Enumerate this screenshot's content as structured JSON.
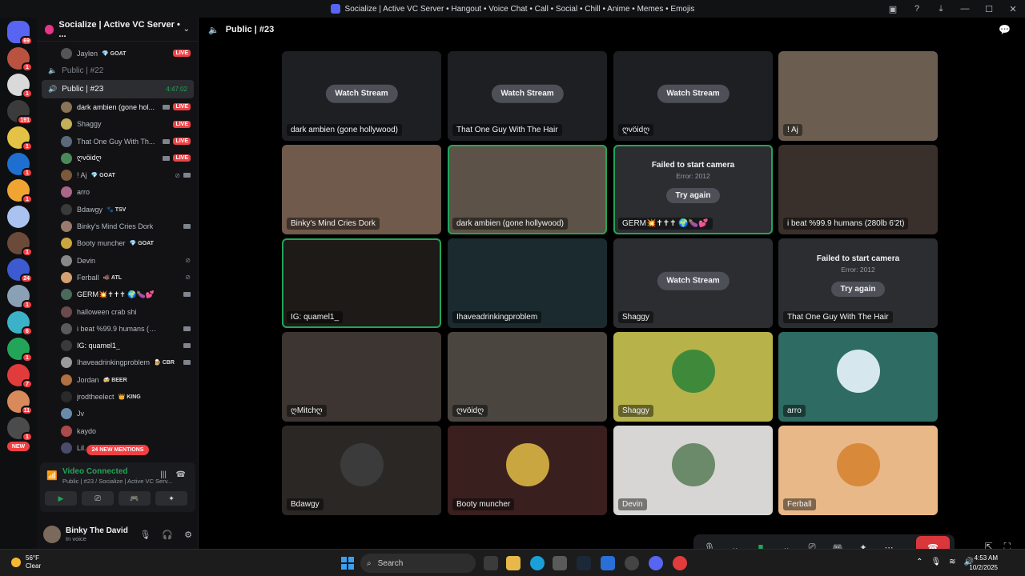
{
  "window": {
    "title": "Socialize | Active VC Server • Hangout • Voice Chat • Call • Social • Chill • Anime • Memes • Emojis"
  },
  "rail": {
    "servers": [
      {
        "color": "#5865f2",
        "badge": "69"
      },
      {
        "color": "#b9523f",
        "badge": "1"
      },
      {
        "color": "#d9d9d9",
        "badge": "1"
      },
      {
        "color": "#3b3b3b",
        "badge": "191"
      },
      {
        "color": "#e3c245",
        "badge": "1"
      },
      {
        "color": "#1f6fd1",
        "badge": "1"
      },
      {
        "color": "#f0a431",
        "badge": "1"
      },
      {
        "color": "#a9c2f0",
        "badge": ""
      },
      {
        "color": "#6b4a3a",
        "badge": "1"
      },
      {
        "color": "#3d5ad1",
        "badge": "24"
      },
      {
        "color": "#8aa1b5",
        "badge": "1"
      },
      {
        "color": "#3bb2c8",
        "badge": "6"
      },
      {
        "color": "#23a559",
        "badge": "1"
      },
      {
        "color": "#e23b3b",
        "badge": "7"
      },
      {
        "color": "#d88a5a",
        "badge": "11"
      },
      {
        "color": "#4b4b4b",
        "badge": "1"
      }
    ],
    "new_label": "NEW"
  },
  "sidebar": {
    "guild_name": "Socialize | Active VC Server • ...",
    "top_user": {
      "name": "Jaylen",
      "tag": "💎 GOAT",
      "live": "LIVE"
    },
    "channel_22": "Public | #22",
    "channel_23": "Public | #23",
    "channel_23_timer": "4:47:02",
    "users": [
      {
        "name": "dark ambien (gone hol...",
        "tag": "",
        "live": "LIVE",
        "cam": true,
        "muted": false,
        "bright": true,
        "color": "#8b7355"
      },
      {
        "name": "Shaggy",
        "tag": "",
        "live": "LIVE",
        "cam": false,
        "muted": false,
        "bright": false,
        "color": "#c2b15a"
      },
      {
        "name": "That One Guy With Th...",
        "tag": "",
        "live": "LIVE",
        "cam": true,
        "muted": false,
        "bright": false,
        "color": "#5a6a7a"
      },
      {
        "name": "ღvöidღ",
        "tag": "",
        "live": "LIVE",
        "cam": true,
        "muted": false,
        "bright": true,
        "color": "#4a8a5a"
      },
      {
        "name": "! Aj",
        "tag": "💎 GOAT",
        "live": "",
        "cam": true,
        "muted": true,
        "bright": false,
        "color": "#7a5a3a"
      },
      {
        "name": "arro",
        "tag": "",
        "live": "",
        "cam": false,
        "muted": false,
        "bright": false,
        "color": "#aa6688"
      },
      {
        "name": "Bdawgy",
        "tag": "🐾 TSV",
        "live": "",
        "cam": false,
        "muted": false,
        "bright": false,
        "color": "#3a3a3a"
      },
      {
        "name": "Binky's Mind Cries Dork",
        "tag": "",
        "live": "",
        "cam": true,
        "muted": false,
        "bright": false,
        "color": "#9a7a6a"
      },
      {
        "name": "Booty muncher",
        "tag": "💎 GOAT",
        "live": "",
        "cam": false,
        "muted": false,
        "bright": false,
        "color": "#c9a640"
      },
      {
        "name": "Devin",
        "tag": "",
        "live": "",
        "cam": false,
        "muted": true,
        "bright": false,
        "color": "#888888"
      },
      {
        "name": "Ferball",
        "tag": "🐗 ATL",
        "live": "",
        "cam": false,
        "muted": true,
        "bright": false,
        "color": "#d4a070"
      },
      {
        "name": "GERM💥✝✝✝ 🌍🍆💕",
        "tag": "",
        "live": "",
        "cam": true,
        "muted": false,
        "bright": true,
        "color": "#4a6a5a"
      },
      {
        "name": "halloween crab shi",
        "tag": "",
        "live": "",
        "cam": false,
        "muted": false,
        "bright": false,
        "color": "#6a4a4a"
      },
      {
        "name": "i beat %99.9 humans (280lb 6...",
        "tag": "",
        "live": "",
        "cam": true,
        "muted": false,
        "bright": false,
        "color": "#5a5a5a"
      },
      {
        "name": "IG: quamel1_",
        "tag": "",
        "live": "",
        "cam": true,
        "muted": false,
        "bright": true,
        "color": "#3a3a3a"
      },
      {
        "name": "Ihaveadrinkingproblem",
        "tag": "🍺 CBR",
        "live": "",
        "cam": true,
        "muted": false,
        "bright": false,
        "color": "#9a9a9a"
      },
      {
        "name": "Jordan",
        "tag": "🍻 BEER",
        "live": "",
        "cam": false,
        "muted": false,
        "bright": false,
        "color": "#b07040"
      },
      {
        "name": "jrodtheelect",
        "tag": "👑 KING",
        "live": "",
        "cam": false,
        "muted": false,
        "bright": false,
        "color": "#2a2a2a"
      },
      {
        "name": "Jv",
        "tag": "",
        "live": "",
        "cam": false,
        "muted": false,
        "bright": false,
        "color": "#6a8aaa"
      },
      {
        "name": "kaydo",
        "tag": "",
        "live": "",
        "cam": false,
        "muted": false,
        "bright": false,
        "color": "#aa4a4a"
      },
      {
        "name": "Lil...",
        "tag": "",
        "live": "",
        "cam": false,
        "muted": false,
        "bright": false,
        "color": "#4a4a6a"
      }
    ],
    "mentions_label": "24 NEW MENTIONS",
    "voice_panel": {
      "status": "Video Connected",
      "subtitle": "Public | #23 / Socialize | Active VC Serv..."
    },
    "user_panel": {
      "name": "Binky The David",
      "status": "In voice"
    }
  },
  "main": {
    "channel_title": "Public | #23",
    "watch_label": "Watch Stream",
    "fail_title": "Failed to start camera",
    "fail_error": "Error: 2012",
    "try_again": "Try again",
    "tiles": [
      {
        "type": "stream",
        "label": "dark ambien (gone hollywood)",
        "bg": "#1e1f22"
      },
      {
        "type": "stream",
        "label": "That One Guy With The Hair",
        "bg": "#1e1f22"
      },
      {
        "type": "stream",
        "label": "ღvöidღ",
        "bg": "#1e1f22"
      },
      {
        "type": "video",
        "label": "! Aj",
        "bg": "#6b5d50"
      },
      {
        "type": "video",
        "label": "Binky's Mind Cries Dork",
        "bg": "#6f5a4c"
      },
      {
        "type": "video",
        "label": "dark ambien (gone hollywood)",
        "bg": "#5d5247",
        "speaking": true
      },
      {
        "type": "fail",
        "label": "GERM💥✝✝✝ 🌍🍆💕",
        "bg": "#2b2d31",
        "speaking": true
      },
      {
        "type": "video",
        "label": "i beat %99.9 humans (280lb 6'2t)",
        "bg": "#3a302b"
      },
      {
        "type": "video",
        "label": "IG: quamel1_",
        "bg": "#1e1a18",
        "speaking": true
      },
      {
        "type": "video",
        "label": "Ihaveadrinkingproblem",
        "bg": "#1b2a2e"
      },
      {
        "type": "stream",
        "label": "Shaggy",
        "bg": "#2b2d31"
      },
      {
        "type": "fail",
        "label": "That One Guy With The Hair",
        "bg": "#2b2d31"
      },
      {
        "type": "video",
        "label": "ღMitchღ",
        "bg": "#3d3531"
      },
      {
        "type": "video",
        "label": "ღvöidღ",
        "bg": "#4a463f"
      },
      {
        "type": "avatar",
        "label": "Shaggy",
        "bg": "#b7b24a",
        "avatar": "#3f8a3a"
      },
      {
        "type": "avatar",
        "label": "arro",
        "bg": "#2e6b62",
        "avatar": "#d6e8ee"
      },
      {
        "type": "avatar",
        "label": "Bdawgy",
        "bg": "#2a2725",
        "avatar": "#3b3b3b"
      },
      {
        "type": "avatar",
        "label": "Booty muncher",
        "bg": "#3a1f1f",
        "avatar": "#c9a640"
      },
      {
        "type": "avatar",
        "label": "Devin",
        "bg": "#d8d6d4",
        "avatar": "#6a8a6a"
      },
      {
        "type": "avatar",
        "label": "Ferball",
        "bg": "#e8b889",
        "avatar": "#d8893a"
      }
    ]
  },
  "taskbar": {
    "temp": "56°F",
    "weather": "Clear",
    "search_placeholder": "Search",
    "time": "4:53 AM",
    "date": "10/2/2025"
  }
}
